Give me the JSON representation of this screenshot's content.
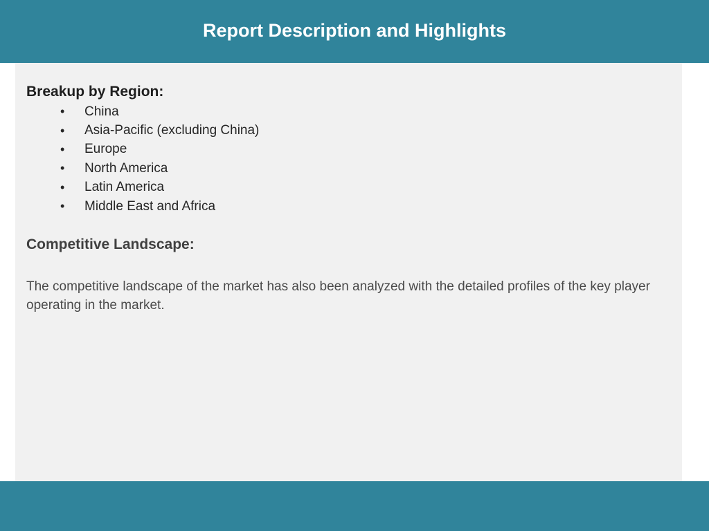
{
  "header": {
    "title": "Report Description and Highlights"
  },
  "regions": {
    "heading": "Breakup by Region:",
    "items": [
      "China",
      "Asia-Pacific (excluding China)",
      "Europe",
      "North America",
      "Latin America",
      "Middle East and Africa"
    ]
  },
  "competitive": {
    "heading": "Competitive Landscape:",
    "description": "The competitive landscape of the market has also been analyzed with the detailed profiles of the key player operating in the market."
  },
  "colors": {
    "header_bg": "#30849b",
    "content_bg": "#f1f1f1"
  }
}
